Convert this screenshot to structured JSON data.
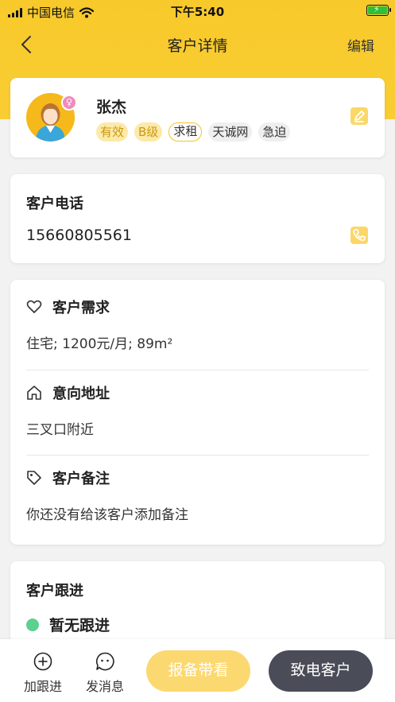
{
  "status_bar": {
    "carrier": "中国电信",
    "time": "下午5:40",
    "battery_level": 1.0
  },
  "nav": {
    "title": "客户详情",
    "edit_label": "编辑"
  },
  "profile": {
    "name": "张杰",
    "gender_symbol": "♀",
    "tags": [
      "有效",
      "B级",
      "求租",
      "天诚网",
      "急迫"
    ]
  },
  "phone": {
    "title": "客户电话",
    "number": "15660805561"
  },
  "details": {
    "demand_title": "客户需求",
    "demand_text": "住宅; 1200元/月; 89m²",
    "address_title": "意向地址",
    "address_text": "三叉口附近",
    "remark_title": "客户备注",
    "remark_text": "你还没有给该客户添加备注"
  },
  "follow": {
    "title": "客户跟进",
    "status": "暂无跟进"
  },
  "bottom": {
    "add_follow": "加跟进",
    "send_message": "发消息",
    "report_label": "报备带看",
    "call_label": "致电客户"
  },
  "colors": {
    "brand_yellow": "#f9cd33",
    "dark_button": "#4a4d58",
    "status_green": "#5cd08f"
  }
}
